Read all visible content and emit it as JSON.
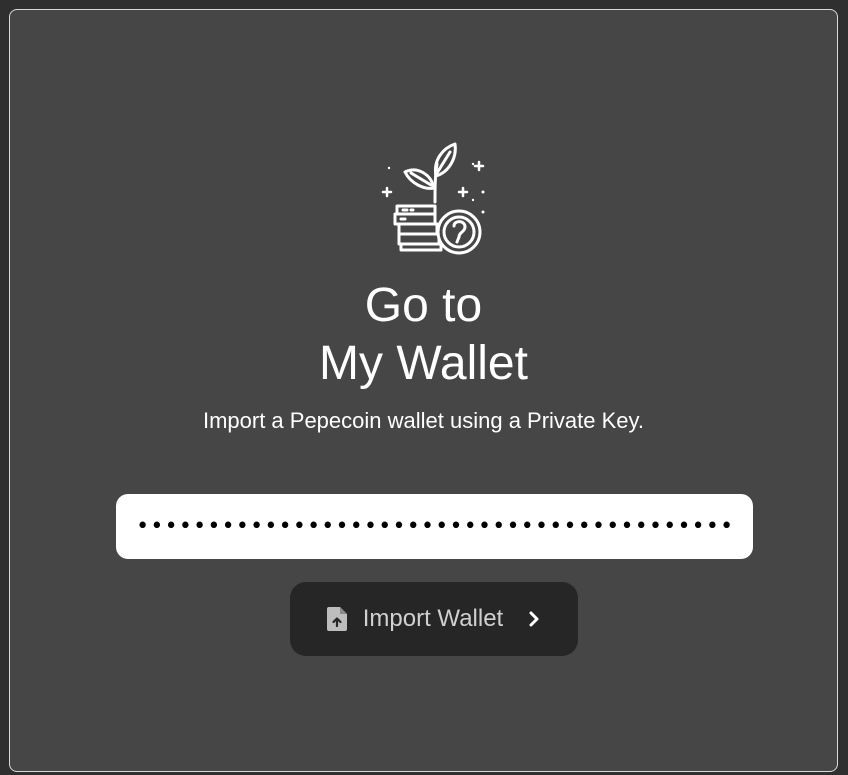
{
  "header": {
    "title_line1": "Go to",
    "title_line2": "My Wallet",
    "subtitle": "Import a Pepecoin wallet using a Private Key."
  },
  "hero": {
    "icon": "plant-coin-growth-icon"
  },
  "form": {
    "private_key_masked": "•••••••••••••••••••••••••••••••••••••••••••••••••••",
    "input_type": "password"
  },
  "actions": {
    "import_label": "Import Wallet",
    "import_icon": "file-upload-icon",
    "chevron_icon": "chevron-right-icon"
  },
  "colors": {
    "background": "#464646",
    "button_bg": "#262626",
    "input_bg": "#ffffff",
    "text": "#ffffff"
  }
}
